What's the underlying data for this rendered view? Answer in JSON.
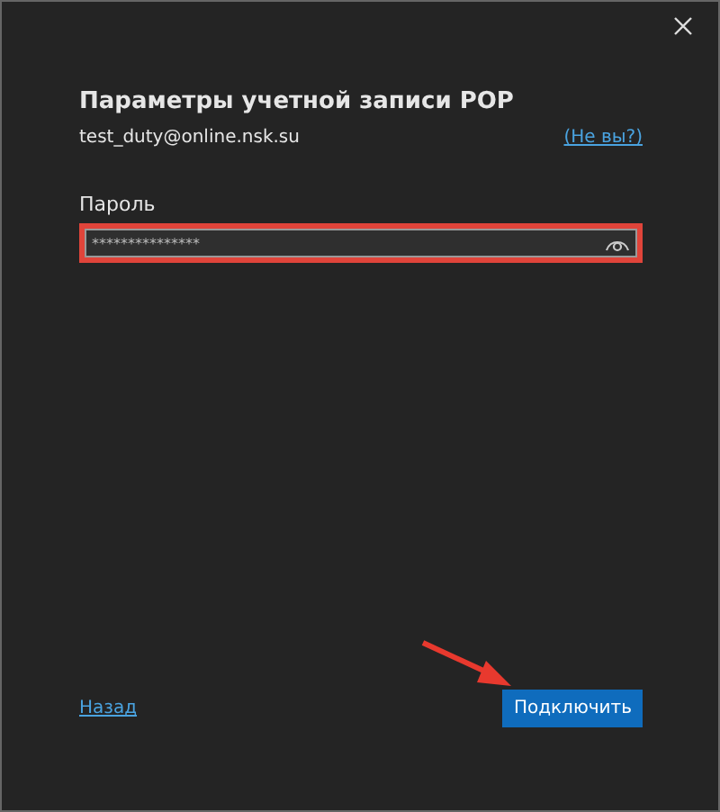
{
  "dialog": {
    "title": "Параметры учетной записи POP",
    "account": "test_duty@online.nsk.su",
    "not_you_link": "(Не вы?)"
  },
  "password": {
    "label": "Пароль",
    "value": "***************",
    "highlighted": true
  },
  "buttons": {
    "back": "Назад",
    "connect": "Подключить"
  }
}
